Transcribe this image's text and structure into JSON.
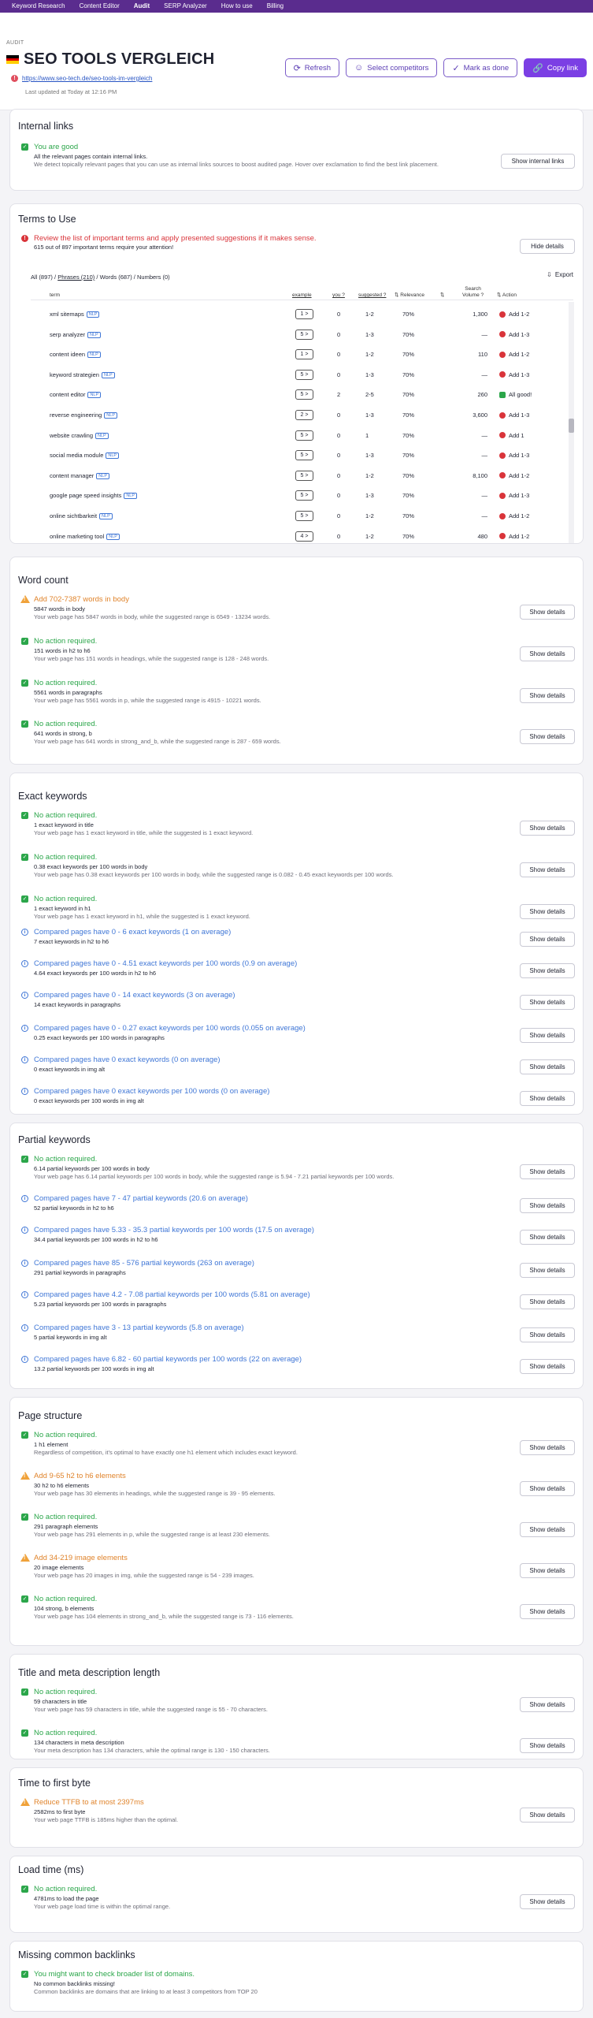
{
  "nav": [
    "Keyword Research",
    "Content Editor",
    "Audit",
    "SERP Analyzer",
    "How to use",
    "Billing"
  ],
  "header": {
    "crumb": "AUDIT",
    "title": "SEO TOOLS VERGLEICH",
    "url": "https://www.seo-tech.de/seo-tools-im-vergleich",
    "updated": "Last updated at Today at 12:16 PM",
    "buttons": {
      "refresh": "Refresh",
      "competitors": "Select competitors",
      "done": "Mark as done",
      "copy": "Copy link"
    }
  },
  "internal_links": {
    "title": "Internal links",
    "status": "You are good",
    "label": "All the relevant pages contain internal links.",
    "desc": "We detect topically relevant pages that you can use as internal links sources to boost audited page. Hover over exclamation to find the best link placement.",
    "button": "Show internal links"
  },
  "terms": {
    "title": "Terms to Use",
    "warning": "Review the list of important terms and apply presented suggestions if it makes sense.",
    "sub": "615 out of 897 important terms require your attention!",
    "hide": "Hide details",
    "tabs": {
      "all": "All (897)",
      "phrases": "Phrases (210)",
      "words": "Words (687)",
      "numbers": "Numbers (0)",
      "sep": " / "
    },
    "export": "Export",
    "headers": {
      "term": "term",
      "example": "example",
      "you": "you ?",
      "suggested": "suggested ?",
      "relevance": "Relevance",
      "volume1": "Search",
      "volume2": "Volume ?",
      "action": "Action"
    },
    "rows": [
      {
        "term": "xml sitemaps",
        "ex": "1 >",
        "you": "0",
        "sug": "1-2",
        "rel": "70%",
        "vol": "1,300",
        "act": "Add 1-2",
        "color": "#d9343a"
      },
      {
        "term": "serp analyzer",
        "ex": "5 >",
        "you": "0",
        "sug": "1-3",
        "rel": "70%",
        "vol": "—",
        "act": "Add 1-3",
        "color": "#d9343a"
      },
      {
        "term": "content ideen",
        "ex": "1 >",
        "you": "0",
        "sug": "1-2",
        "rel": "70%",
        "vol": "110",
        "act": "Add 1-2",
        "color": "#d9343a"
      },
      {
        "term": "keyword strategien",
        "ex": "5 >",
        "you": "0",
        "sug": "1-3",
        "rel": "70%",
        "vol": "—",
        "act": "Add 1-3",
        "color": "#d9343a"
      },
      {
        "term": "content editor",
        "ex": "5 >",
        "you": "2",
        "sug": "2-5",
        "rel": "70%",
        "vol": "260",
        "act": "All good!",
        "color": "#2ba64a"
      },
      {
        "term": "reverse engineering",
        "ex": "2 >",
        "you": "0",
        "sug": "1-3",
        "rel": "70%",
        "vol": "3,600",
        "act": "Add 1-3",
        "color": "#d9343a"
      },
      {
        "term": "website crawling",
        "ex": "5 >",
        "you": "0",
        "sug": "1",
        "rel": "70%",
        "vol": "—",
        "act": "Add 1",
        "color": "#d9343a"
      },
      {
        "term": "social media module",
        "ex": "5 >",
        "you": "0",
        "sug": "1-3",
        "rel": "70%",
        "vol": "—",
        "act": "Add 1-3",
        "color": "#d9343a"
      },
      {
        "term": "content manager",
        "ex": "5 >",
        "you": "0",
        "sug": "1-2",
        "rel": "70%",
        "vol": "8,100",
        "act": "Add 1-2",
        "color": "#d9343a"
      },
      {
        "term": "google page speed insights",
        "ex": "5 >",
        "you": "0",
        "sug": "1-3",
        "rel": "70%",
        "vol": "—",
        "act": "Add 1-3",
        "color": "#d9343a"
      },
      {
        "term": "online sichtbarkeit",
        "ex": "5 >",
        "you": "0",
        "sug": "1-2",
        "rel": "70%",
        "vol": "—",
        "act": "Add 1-2",
        "color": "#d9343a"
      },
      {
        "term": "online marketing tool",
        "ex": "4 >",
        "you": "0",
        "sug": "1-2",
        "rel": "70%",
        "vol": "480",
        "act": "Add 1-2",
        "color": "#d9343a"
      }
    ],
    "nlp": "NLP"
  },
  "sections": [
    {
      "title": "Word count",
      "items": [
        {
          "type": "warn",
          "title": "Add 702-7387 words in body",
          "label": "5847 words in body",
          "desc": "Your web page has 5847 words in body, while the suggested range is 6549 - 13234 words."
        },
        {
          "type": "ok",
          "title": "No action required.",
          "label": "151 words in h2 to h6",
          "desc": "Your web page has 151 words in headings, while the suggested range is 128 - 248 words."
        },
        {
          "type": "ok",
          "title": "No action required.",
          "label": "5561 words in paragraphs",
          "desc": "Your web page has 5561 words in p, while the suggested range is 4915 - 10221 words."
        },
        {
          "type": "ok",
          "title": "No action required.",
          "label": "641 words in strong, b",
          "desc": "Your web page has 641 words in strong_and_b, while the suggested range is 287 - 659 words."
        }
      ]
    },
    {
      "title": "Exact keywords",
      "items": [
        {
          "type": "ok",
          "title": "No action required.",
          "label": "1 exact keyword in title",
          "desc": "Your web page has 1 exact keyword in title, while the suggested is 1 exact keyword."
        },
        {
          "type": "ok",
          "title": "No action required.",
          "label": "0.38 exact keywords per 100 words in body",
          "desc": "Your web page has 0.38 exact keywords per 100 words in body, while the suggested range is 0.082 - 0.45 exact keywords per 100 words."
        },
        {
          "type": "ok",
          "title": "No action required.",
          "label": "1 exact keyword in h1",
          "desc": "Your web page has 1 exact keyword in h1, while the suggested is 1 exact keyword."
        },
        {
          "type": "info",
          "title": "Compared pages have 0 - 6 exact keywords (1 on average)",
          "label": "7 exact keywords in h2 to h6",
          "desc": ""
        },
        {
          "type": "info",
          "title": "Compared pages have 0 - 4.51 exact keywords per 100 words (0.9 on average)",
          "label": "4.64 exact keywords per 100 words in h2 to h6",
          "desc": ""
        },
        {
          "type": "info",
          "title": "Compared pages have 0 - 14 exact keywords (3 on average)",
          "label": "14 exact keywords in paragraphs",
          "desc": ""
        },
        {
          "type": "info",
          "title": "Compared pages have 0 - 0.27 exact keywords per 100 words (0.055 on average)",
          "label": "0.25 exact keywords per 100 words in paragraphs",
          "desc": ""
        },
        {
          "type": "info",
          "title": "Compared pages have 0 exact keywords (0 on average)",
          "label": "0 exact keywords in img alt",
          "desc": ""
        },
        {
          "type": "info",
          "title": "Compared pages have 0 exact keywords per 100 words (0 on average)",
          "label": "0 exact keywords per 100 words in img alt",
          "desc": ""
        }
      ]
    },
    {
      "title": "Partial keywords",
      "items": [
        {
          "type": "ok",
          "title": "No action required.",
          "label": "6.14 partial keywords per 100 words in body",
          "desc": "Your web page has 6.14 partial keywords per 100 words in body, while the suggested range is 5.94 - 7.21 partial keywords per 100 words."
        },
        {
          "type": "info",
          "title": "Compared pages have 7 - 47 partial keywords (20.6 on average)",
          "label": "52 partial keywords in h2 to h6",
          "desc": ""
        },
        {
          "type": "info",
          "title": "Compared pages have 5.33 - 35.3 partial keywords per 100 words (17.5 on average)",
          "label": "34.4 partial keywords per 100 words in h2 to h6",
          "desc": ""
        },
        {
          "type": "info",
          "title": "Compared pages have 85 - 576 partial keywords (263 on average)",
          "label": "291 partial keywords in paragraphs",
          "desc": ""
        },
        {
          "type": "info",
          "title": "Compared pages have 4.2 - 7.08 partial keywords per 100 words (5.81 on average)",
          "label": "5.23 partial keywords per 100 words in paragraphs",
          "desc": ""
        },
        {
          "type": "info",
          "title": "Compared pages have 3 - 13 partial keywords (5.8 on average)",
          "label": "5 partial keywords in img alt",
          "desc": ""
        },
        {
          "type": "info",
          "title": "Compared pages have 6.82 - 60 partial keywords per 100 words (22 on average)",
          "label": "13.2 partial keywords per 100 words in img alt",
          "desc": ""
        }
      ]
    },
    {
      "title": "Page structure",
      "items": [
        {
          "type": "ok",
          "title": "No action required.",
          "label": "1 h1 element",
          "desc": "Regardless of competition, it's optimal to have exactly one h1 element which includes exact keyword."
        },
        {
          "type": "warn",
          "title": "Add 9-65 h2 to h6 elements",
          "label": "30 h2 to h6 elements",
          "desc": "Your web page has 30 elements in headings, while the suggested range is 39 - 95 elements."
        },
        {
          "type": "ok",
          "title": "No action required.",
          "label": "291 paragraph elements",
          "desc": "Your web page has 291 elements in p, while the suggested range is at least 230 elements."
        },
        {
          "type": "warn",
          "title": "Add 34-219 image elements",
          "label": "20 image elements",
          "desc": "Your web page has 20 images in img, while the suggested range is 54 - 239 images."
        },
        {
          "type": "ok",
          "title": "No action required.",
          "label": "104 strong, b elements",
          "desc": "Your web page has 104 elements in strong_and_b, while the suggested range is 73 - 116 elements."
        }
      ]
    },
    {
      "title": "Title and meta description length",
      "items": [
        {
          "type": "ok",
          "title": "No action required.",
          "label": "59 characters in title",
          "desc": "Your web page has 59 characters in title, while the suggested range is 55 - 70 characters."
        },
        {
          "type": "ok",
          "title": "No action required.",
          "label": "134 characters in meta description",
          "desc": "Your meta description has 134 characters, while the optimal range is 130 - 150 characters."
        }
      ]
    },
    {
      "title": "Time to first byte",
      "items": [
        {
          "type": "warn",
          "title": "Reduce TTFB to at most 2397ms",
          "label": "2582ms to first byte",
          "desc": "Your web page TTFB is 185ms higher than the optimal."
        }
      ]
    },
    {
      "title": "Load time (ms)",
      "items": [
        {
          "type": "ok",
          "title": "No action required.",
          "label": "4781ms to load the page",
          "desc": "Your web page load time is within the optimal range."
        }
      ]
    },
    {
      "title": "Missing common backlinks",
      "items": [
        {
          "type": "ok",
          "title": "You might want to check broader list of domains.",
          "label": "No common backlinks missing!",
          "desc": "Common backlinks are domains that are linking to at least 3 competitors from TOP 20"
        }
      ]
    }
  ],
  "show_details": "Show details"
}
